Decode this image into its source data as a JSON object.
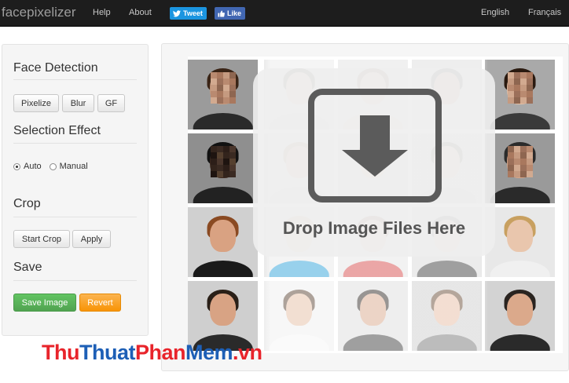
{
  "navbar": {
    "brand": "facepixelizer",
    "links": [
      "Help",
      "About"
    ],
    "tweet_label": "Tweet",
    "like_label": "Like",
    "languages": [
      "English",
      "Français"
    ]
  },
  "panel": {
    "face_detection": {
      "title": "Face Detection",
      "buttons": [
        "Pixelize",
        "Blur",
        "GF"
      ]
    },
    "selection_effect": {
      "title": "Selection Effect",
      "options": [
        "Auto",
        "Manual"
      ],
      "selected": "Auto"
    },
    "crop": {
      "title": "Crop",
      "buttons": [
        "Start Crop",
        "Apply"
      ]
    },
    "save": {
      "title": "Save",
      "save_button": "Save Image",
      "revert_button": "Revert"
    }
  },
  "dropzone": {
    "text": "Drop Image Files Here",
    "icon": "download-arrow-icon"
  },
  "watermark": {
    "parts": [
      "Thu",
      "Thuat",
      "Phan",
      "Mem",
      ".vn"
    ],
    "colors": [
      "#e8242b",
      "#1d5fb6",
      "#e8242b",
      "#1d5fb6",
      "#e8242b"
    ]
  },
  "colors": {
    "navbar_bg": "#1d1d1d",
    "save_green": "#5bb75b",
    "revert_orange": "#faa732",
    "tweet_blue": "#1b95e0",
    "like_blue": "#4267b2"
  }
}
